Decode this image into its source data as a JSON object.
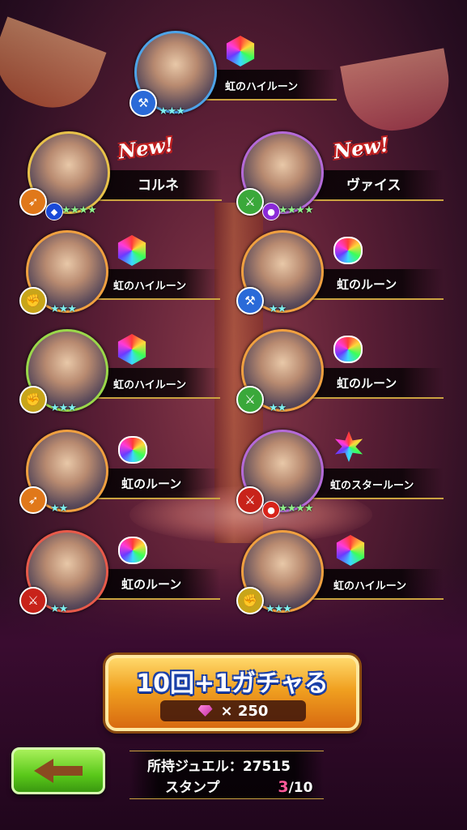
{
  "cards": [
    {
      "id": "c1",
      "label": "虹のハイルーン",
      "rune": "hex",
      "stars": "★★★",
      "new": false
    },
    {
      "id": "c2",
      "label": "コルネ",
      "rune": null,
      "stars": "★★★★",
      "new": true
    },
    {
      "id": "c3",
      "label": "ヴァイス",
      "rune": null,
      "stars": "★★★★",
      "new": true
    },
    {
      "id": "c4",
      "label": "虹のハイルーン",
      "rune": "hex",
      "stars": "★★★",
      "new": false
    },
    {
      "id": "c5",
      "label": "虹のルーン",
      "rune": "drop",
      "stars": "★★",
      "new": false
    },
    {
      "id": "c6",
      "label": "虹のハイルーン",
      "rune": "hex",
      "stars": "★★★",
      "new": false
    },
    {
      "id": "c7",
      "label": "虹のルーン",
      "rune": "drop",
      "stars": "★★",
      "new": false
    },
    {
      "id": "c8",
      "label": "虹のルーン",
      "rune": "drop",
      "stars": "★★",
      "new": false
    },
    {
      "id": "c9",
      "label": "虹のスタールーン",
      "rune": "star",
      "stars": "★★★★",
      "new": false
    },
    {
      "id": "c10",
      "label": "虹のルーン",
      "rune": "drop",
      "stars": "★★",
      "new": false
    },
    {
      "id": "c11",
      "label": "虹のハイルーン",
      "rune": "hex",
      "stars": "★★★",
      "new": false
    }
  ],
  "new_badge": "New!",
  "gacha_button": {
    "title": "10回+1ガチャる",
    "cost": "× 250"
  },
  "status": {
    "jewel_label": "所持ジュエル：",
    "jewel_value": "27515",
    "stamp_label": "スタンプ",
    "stamp_current": "3",
    "stamp_total": "/10"
  },
  "icons": {
    "back": "back-arrow-icon",
    "gem": "gem-icon"
  }
}
